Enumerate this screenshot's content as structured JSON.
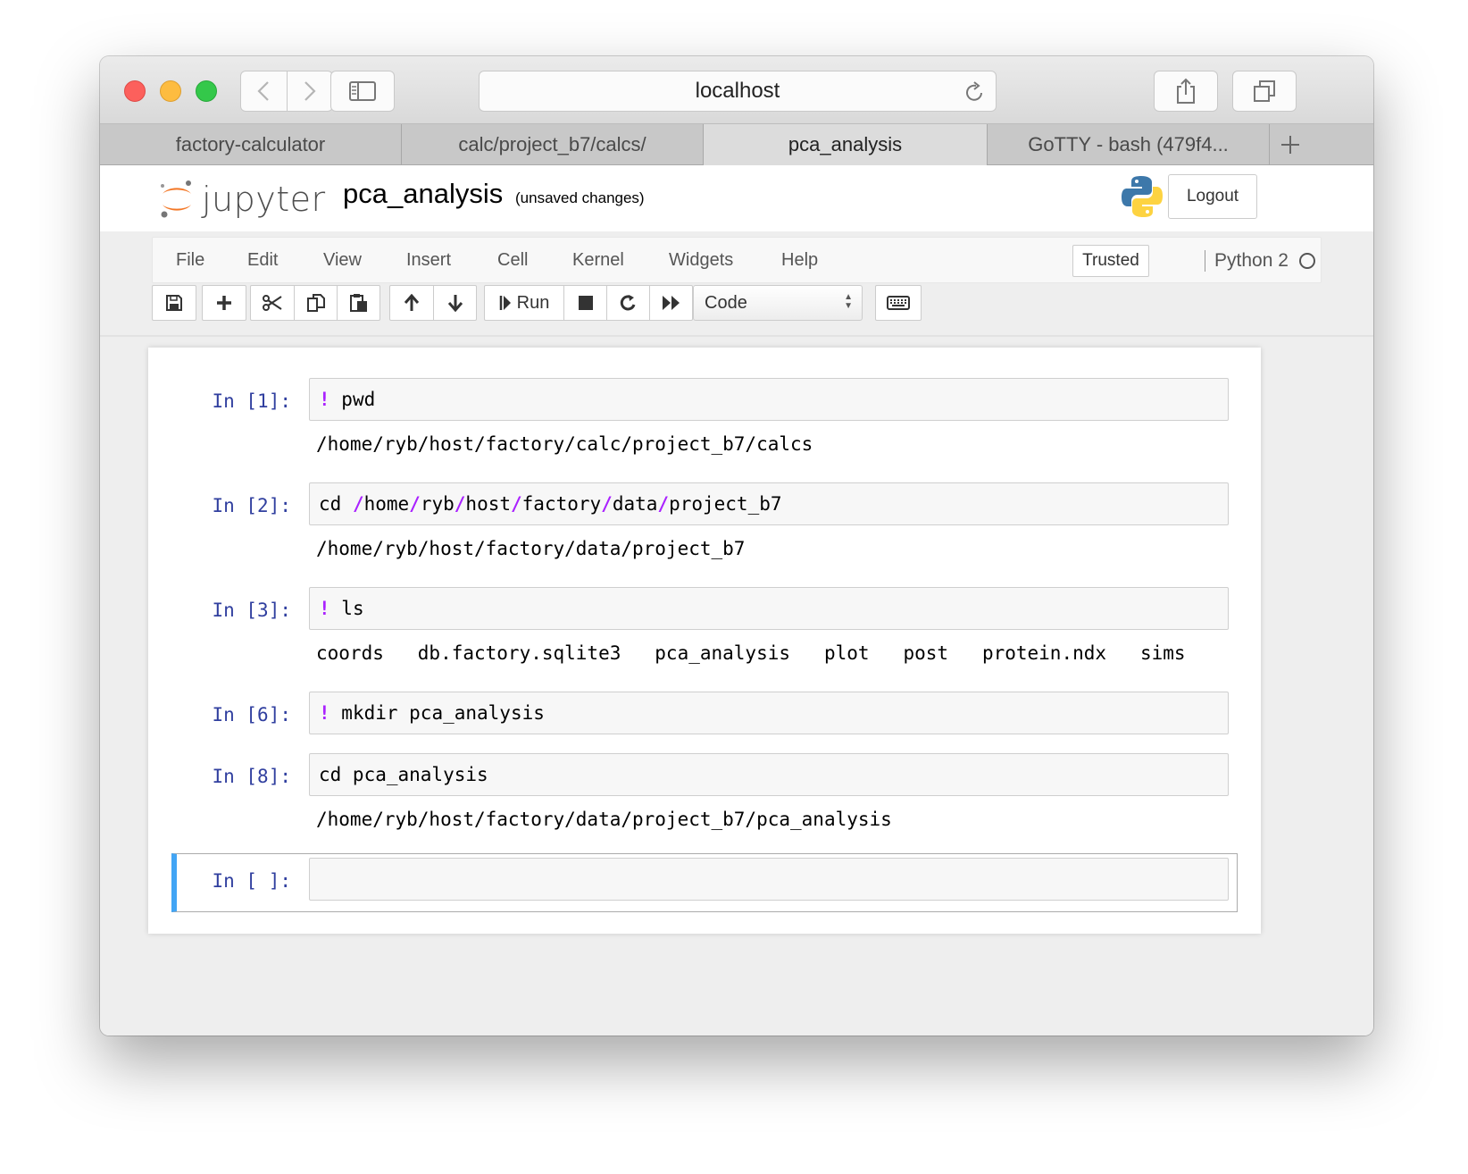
{
  "browser": {
    "url": "localhost",
    "tabs": [
      "factory-calculator",
      "calc/project_b7/calcs/",
      "pca_analysis",
      "GoTTY - bash (479f4..."
    ],
    "active_tab": 2
  },
  "header": {
    "logo_text": "jupyter",
    "notebook_name": "pca_analysis",
    "save_status": "(unsaved changes)",
    "logout_label": "Logout"
  },
  "menubar": {
    "items": [
      "File",
      "Edit",
      "View",
      "Insert",
      "Cell",
      "Kernel",
      "Widgets",
      "Help"
    ],
    "trusted_label": "Trusted",
    "kernel_name": "Python 2"
  },
  "toolbar": {
    "run_label": "Run",
    "cell_type": "Code"
  },
  "cells": [
    {
      "prompt": "In [1]:",
      "bang": "!",
      "code": " pwd",
      "output": "/home/ryb/host/factory/calc/project_b7/calcs"
    },
    {
      "prompt": "In [2]:",
      "code_parts": [
        "cd ",
        "/",
        "home",
        "/",
        "ryb",
        "/",
        "host",
        "/",
        "factory",
        "/",
        "data",
        "/",
        "project_b7"
      ],
      "output": "/home/ryb/host/factory/data/project_b7"
    },
    {
      "prompt": "In [3]:",
      "bang": "!",
      "code": " ls",
      "output": "coords   db.factory.sqlite3   pca_analysis   plot   post   protein.ndx   sims"
    },
    {
      "prompt": "In [6]:",
      "bang": "!",
      "code": " mkdir pca_analysis"
    },
    {
      "prompt": "In [8]:",
      "code": "cd pca_analysis",
      "output": "/home/ryb/host/factory/data/project_b7/pca_analysis"
    },
    {
      "prompt": "In [ ]:",
      "code": ""
    }
  ],
  "colors": {
    "prompt": "#303f9f",
    "magic": "#aa22ff",
    "selected_border": "#42a5f5"
  }
}
